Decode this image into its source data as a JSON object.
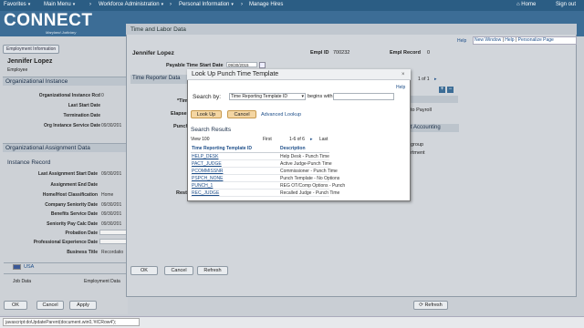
{
  "topnav": {
    "favorites": "Favorites",
    "main_menu": "Main Menu",
    "workforce": "Workforce Administration",
    "personal": "Personal Information",
    "manage_hires": "Manage Hires",
    "home": "Home",
    "signout": "Sign out"
  },
  "brand": {
    "logo": "CONNECT",
    "sub": "Maryland Judiciary"
  },
  "left": {
    "tab": "Employment Information",
    "name": "Jennifer Lopez",
    "role": "Employee",
    "org_section": "Organizational Instance",
    "org_fields": [
      {
        "label": "Organizational Instance Rcd",
        "value": "0"
      },
      {
        "label": "Last Start Date",
        "value": ""
      },
      {
        "label": "Termination Date",
        "value": ""
      },
      {
        "label": "Org Instance Service Date",
        "value": "09/30/201"
      }
    ],
    "assign_section": "Organizational Assignment Data",
    "instance_record": "Instance Record",
    "assign_fields": [
      {
        "label": "Last Assignment Start Date",
        "value": "09/30/201"
      },
      {
        "label": "Assignment End Date",
        "value": ""
      },
      {
        "label": "Home/Host Classification",
        "value": "Home"
      },
      {
        "label": "Company Seniority Date",
        "value": "09/30/201"
      },
      {
        "label": "Benefits Service Date",
        "value": "09/30/201"
      },
      {
        "label": "Seniority Pay Calc Date",
        "value": "09/30/201"
      },
      {
        "label": "Probation Date",
        "value": ""
      },
      {
        "label": "Professional Experience Date",
        "value": ""
      },
      {
        "label": "Business Title",
        "value": "Recordatio"
      }
    ],
    "country": "USA",
    "job_data": "Job Data",
    "employment_data": "Employment Data",
    "ok": "OK",
    "cancel": "Cancel",
    "apply": "Apply"
  },
  "tl": {
    "title": "Time and Labor Data",
    "help": "Help",
    "links": [
      "New Window",
      "Help",
      "Personalize Page"
    ],
    "name": "Jennifer Lopez",
    "empl_id_label": "Empl ID",
    "empl_id": "700232",
    "empl_record_label": "Empl Record",
    "empl_record": "0",
    "payable_label": "Payable Time Start Date",
    "payable_date": "09/30/2015",
    "reporter_section": "Time Reporter Data",
    "frag_time": "*Tim",
    "frag_elapsed": "Elapse",
    "frag_punch": "Punch",
    "frag_rest": "Rest",
    "pager": "1 of 1",
    "to_payroll": "to Payroll",
    "accounting": "t Accounting",
    "group": "group",
    "rtment": "rtment",
    "ok": "OK",
    "cancel": "Cancel",
    "refresh": "Refresh",
    "refresh2": "Refresh"
  },
  "modal": {
    "title": "Look Up Punch Time Template",
    "close": "×",
    "help": "Help",
    "search_by": "Search by:",
    "search_select": "Time Reporting Template ID",
    "begins_with": "begins with",
    "lookup": "Look Up",
    "cancel": "Cancel",
    "advanced": "Advanced Lookup",
    "results_title": "Search Results",
    "view": "View 100",
    "first": "First",
    "range": "1-6 of 6",
    "last": "Last",
    "col1": "Time Reporting Template ID",
    "col2": "Description",
    "rows": [
      {
        "id": "HELP_DESK",
        "desc": "Help Desk - Punch Time"
      },
      {
        "id": "PACT_JUDGE",
        "desc": "Active Judge-Punch Time"
      },
      {
        "id": "PCOMMISSNR",
        "desc": "Commissioner - Punch Time"
      },
      {
        "id": "PSPCH_NONE",
        "desc": "Punch Template - No Options"
      },
      {
        "id": "PUNCH_1",
        "desc": "REG OT/Comp Options - Punch"
      },
      {
        "id": "REC_JUDGE",
        "desc": "Recalled Judge - Punch Time"
      }
    ]
  },
  "status": {
    "text": "javascript:doUpdateParent(document.win0,'#ICRow4');"
  },
  "colors": {
    "nav": "#2b5d84",
    "header": "#3c6d96",
    "button": "#f4d6a3",
    "link": "#1d4e89"
  }
}
